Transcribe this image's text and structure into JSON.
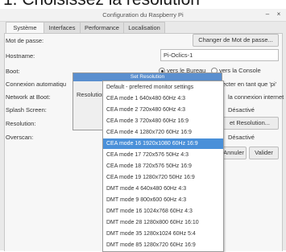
{
  "caption": "1. Choisissez la résolution",
  "window": {
    "title": "Configuration du Raspberry Pi",
    "minimize_glyph": "–",
    "close_glyph": "×"
  },
  "tabs": [
    "Système",
    "Interfaces",
    "Performance",
    "Localisation"
  ],
  "active_tab": "Système",
  "form": {
    "password_label": "Mot de passe:",
    "change_password_button": "Changer de Mot de passe...",
    "hostname_label": "Hostname:",
    "hostname_value": "Pi-Oclics-1",
    "boot_label": "Boot:",
    "boot_desktop": "vers le Bureau",
    "boot_console": "vers la Console",
    "boot_selected": "vers le Bureau",
    "autologin_label": "Connexion automatiqu",
    "autologin_right": "ecter en tant que 'pi'",
    "network_label": "Network at Boot:",
    "network_right": "la connexion internet",
    "splash_label": "Splash Screen:",
    "splash_right": "Désactivé",
    "resolution_label": "Resolution:",
    "resolution_button": "et Resolution...",
    "overscan_label": "Overscan:",
    "overscan_right": "Désactivé",
    "cancel_button": "Annuler",
    "ok_button": "Valider"
  },
  "resolution_dialog": {
    "title": "Set Resolution",
    "label": "Resolution:"
  },
  "resolution_options": [
    "Default - preferred monitor settings",
    "CEA mode 1 640x480 60Hz 4:3",
    "CEA mode 2 720x480 60Hz 4:3",
    "CEA mode 3 720x480 60Hz 16:9",
    "CEA mode 4 1280x720 60Hz 16:9",
    "CEA mode 16 1920x1080 60Hz 16:9",
    "CEA mode 17 720x576 50Hz 4:3",
    "CEA mode 18 720x576 50Hz 16:9",
    "CEA mode 19 1280x720 50Hz 16:9",
    "DMT mode 4 640x480 60Hz 4:3",
    "DMT mode 9 800x600 60Hz 4:3",
    "DMT mode 16 1024x768 60Hz 4:3",
    "DMT mode 28 1280x800 60Hz 16:10",
    "DMT mode 35 1280x1024 60Hz 5:4",
    "DMT mode 85 1280x720 60Hz 16:9"
  ],
  "selected_resolution": "CEA mode 16 1920x1080 60Hz 16:9",
  "colors": {
    "selection": "#4a90d9",
    "dialog_title_bar": "#5a8fcf"
  }
}
